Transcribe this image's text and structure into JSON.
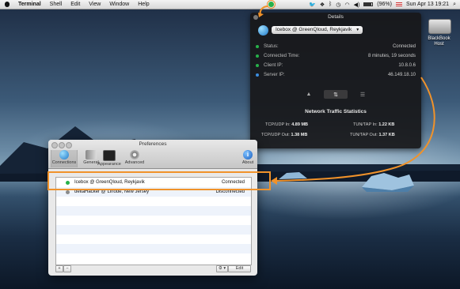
{
  "menubar": {
    "app": "Terminal",
    "items": [
      "Shell",
      "Edit",
      "View",
      "Window",
      "Help"
    ],
    "battery": "(96%)",
    "clock": "Sun Apr 13  19:21",
    "icons": [
      "vpn-status-icon",
      "twitter-icon",
      "dropbox-icon",
      "bluetooth-icon",
      "time-machine-icon",
      "wifi-icon",
      "volume-icon",
      "battery-icon",
      "flag-icon",
      "search-icon"
    ]
  },
  "details": {
    "title": "Details",
    "connection": "Icebox @ GreenQloud, Reykjavik",
    "rows": [
      {
        "label": "Status:",
        "value": "Connected",
        "color": "#27b14a"
      },
      {
        "label": "Connected Time:",
        "value": "8 minutes, 19 seconds",
        "color": "#27b14a"
      },
      {
        "label": "Client IP:",
        "value": "10.8.0.6",
        "color": "#27b14a"
      },
      {
        "label": "Server IP:",
        "value": "46.149.18.10",
        "color": "#3b8de0"
      }
    ],
    "stats_title": "Network Traffic Statistics",
    "tcp_in_label": "TCP/UDP In:",
    "tcp_in": "4.89 MB",
    "tcp_out_label": "TCP/UDP Out:",
    "tcp_out": "1.38 MB",
    "tun_in_label": "TUN/TAP In:",
    "tun_in": "1.22 KB",
    "tun_out_label": "TUN/TAP Out:",
    "tun_out": "1.37 KB"
  },
  "drive": {
    "label": "BlackBook\nHost"
  },
  "prefs": {
    "title": "Preferences",
    "toolbar": [
      {
        "label": "Connections"
      },
      {
        "label": "General"
      },
      {
        "label": "Appearance"
      },
      {
        "label": "Advanced"
      }
    ],
    "about": "About",
    "connections": [
      {
        "name": "Icebox @ GreenQloud, Reykjavik",
        "state": "Connected",
        "color": "#27b14a"
      },
      {
        "name": "deltaHacker @ Linode, New Jersey",
        "state": "Disconnected",
        "color": "#8a8a8a"
      }
    ],
    "add": "+",
    "remove": "−",
    "gear": "⚙ ▾",
    "edit": "Edit"
  },
  "colors": {
    "accent": "#f0922a",
    "connected": "#27b14a"
  }
}
